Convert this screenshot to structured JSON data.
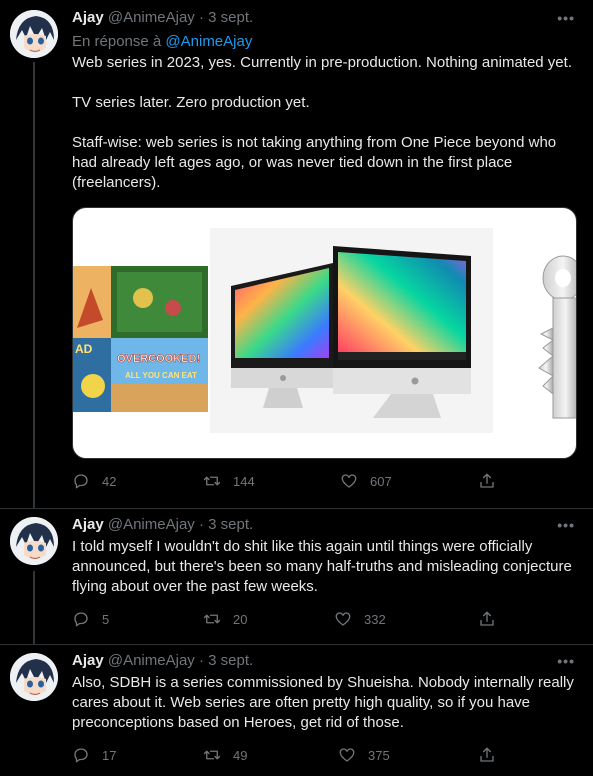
{
  "tweets": [
    {
      "name": "Ajay",
      "handle": "@AnimeAjay",
      "dot": "·",
      "date": "3 sept.",
      "reply_prefix": "En réponse à",
      "reply_handle": "@AnimeAjay",
      "paragraphs": [
        "Web series in 2023, yes. Currently in pre-production. Nothing animated yet.",
        "TV series later. Zero production yet.",
        "Staff-wise: web series is not taking anything from One Piece beyond who had already left ages ago, or was never tied down in the first place (freelancers)."
      ],
      "media_text": "OVERCOOKED! ALL YOU CAN EAT",
      "media_text_left": "AD",
      "replies": "42",
      "retweets": "144",
      "likes": "607"
    },
    {
      "name": "Ajay",
      "handle": "@AnimeAjay",
      "dot": "·",
      "date": "3 sept.",
      "text": "I told myself I wouldn't do shit like this again until things were officially announced, but there's been so many half-truths and misleading conjecture flying about over the past few weeks.",
      "replies": "5",
      "retweets": "20",
      "likes": "332"
    },
    {
      "name": "Ajay",
      "handle": "@AnimeAjay",
      "dot": "·",
      "date": "3 sept.",
      "text": "Also, SDBH is a series commissioned by Shueisha. Nobody internally really cares about it. Web series are often pretty high quality, so if you have preconceptions based on Heroes, get rid of those.",
      "replies": "17",
      "retweets": "49",
      "likes": "375"
    }
  ],
  "colors": {
    "background": "#000000",
    "text": "#e7e9ea",
    "muted": "#71767b",
    "link": "#1d9bf0",
    "border": "#2f3336"
  },
  "icons": [
    "avatar",
    "more-icon",
    "reply-icon",
    "retweet-icon",
    "like-icon",
    "share-icon"
  ]
}
